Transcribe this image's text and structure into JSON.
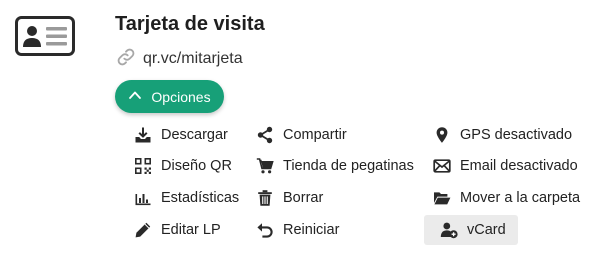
{
  "header": {
    "title": "Tarjeta de visita",
    "url": "qr.vc/mitarjeta",
    "icon": "id-card-icon"
  },
  "options_button": {
    "label": "Opciones",
    "icon": "chevron-up-icon",
    "color": "#17a078"
  },
  "menu": {
    "col1": [
      {
        "label": "Descargar",
        "icon": "download-icon"
      },
      {
        "label": "Diseño QR",
        "icon": "qr-code-icon"
      },
      {
        "label": "Estadísticas",
        "icon": "bar-chart-icon"
      },
      {
        "label": "Editar LP",
        "icon": "pencil-icon"
      }
    ],
    "col2": [
      {
        "label": "Compartir",
        "icon": "share-icon"
      },
      {
        "label": "Tienda de pegatinas",
        "icon": "cart-icon"
      },
      {
        "label": "Borrar",
        "icon": "trash-icon"
      },
      {
        "label": "Reiniciar",
        "icon": "undo-icon"
      }
    ],
    "col3": [
      {
        "label": "GPS desactivado",
        "icon": "map-pin-icon"
      },
      {
        "label": "Email desactivado",
        "icon": "envelope-icon"
      },
      {
        "label": "Mover a la carpeta",
        "icon": "folder-open-icon"
      },
      {
        "label": "vCard",
        "icon": "user-plus-icon",
        "highlighted": true
      }
    ]
  }
}
